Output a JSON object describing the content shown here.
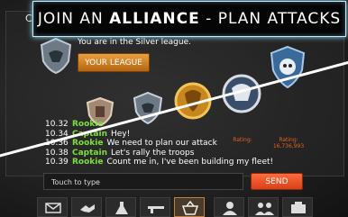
{
  "banner": {
    "pre": "JOIN AN ",
    "bold": "ALLIANCE",
    "post": " - PLAN ATTACKS"
  },
  "header": {
    "close_label": "Clo"
  },
  "league": {
    "text": "You are in the Silver league.",
    "button_label": "YOUR LEAGUE"
  },
  "ratings": [
    {
      "label": "Rating:"
    },
    {
      "label": "Rating:",
      "value": "16,736,993"
    }
  ],
  "chat": {
    "messages": [
      {
        "time": "10.32",
        "name": "Rookie",
        "text": ""
      },
      {
        "time": "10.34",
        "name": "Captain",
        "text": "Hey!"
      },
      {
        "time": "10.36",
        "name": "Rookie",
        "text": "We need to plan our attack"
      },
      {
        "time": "10.38",
        "name": "Captain",
        "text": "Let's rally the troops"
      },
      {
        "time": "10.39",
        "name": "Rookie",
        "text": "Count me in, I've been building my fleet!"
      }
    ],
    "input_placeholder": "Touch to type",
    "send_label": "SEND"
  },
  "nav": {
    "items": [
      {
        "icon": "mail-icon"
      },
      {
        "icon": "handshake-icon"
      },
      {
        "icon": "flask-icon"
      },
      {
        "icon": "gun-icon"
      },
      {
        "icon": "shop-basket-icon",
        "active": true
      },
      {
        "icon": "person-icon"
      },
      {
        "icon": "group-icon"
      },
      {
        "icon": "alliance-icon"
      }
    ]
  },
  "colors": {
    "accent_orange": "#d8401a",
    "chat_name_green": "#7ee03a",
    "banner_glow": "#9fe6ff"
  }
}
